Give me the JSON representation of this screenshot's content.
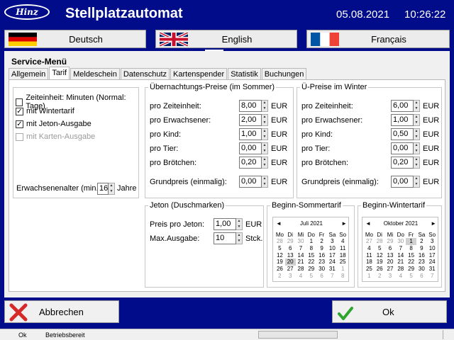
{
  "header": {
    "logo_text": "Hinz",
    "title": "Stellplatzautomat",
    "date": "05.08.2021",
    "time": "10:26:22"
  },
  "languages": [
    {
      "label": "Deutsch",
      "flag": "de-flag"
    },
    {
      "label": "English",
      "flag": "uk-flag"
    },
    {
      "label": "Français",
      "flag": "fr-flag"
    }
  ],
  "panel": {
    "title": "Service-Menü",
    "tabs": [
      "Allgemein",
      "Tarif",
      "Meldeschein",
      "Datenschutz",
      "Kartenspender",
      "Statistik",
      "Buchungen"
    ],
    "active_tab": "Tarif"
  },
  "options": {
    "zeiteinheit": {
      "label": "Zeiteinheit: Minuten (Normal: Tage)",
      "checked": false
    },
    "wintertarif": {
      "label": "mit Wintertarif",
      "checked": true
    },
    "jeton": {
      "label": "mit Jeton-Ausgabe",
      "checked": true
    },
    "karten": {
      "label": "mit Karten-Ausgabe",
      "checked": false,
      "disabled": true
    },
    "erwachsenenalter": {
      "label": "Erwachsenenalter (min.):",
      "value": "16",
      "unit": "Jahre"
    }
  },
  "sommer": {
    "title": "Übernachtungs-Preise (im Sommer)",
    "rows": [
      {
        "label": "pro Zeiteinheit:",
        "value": "8,00",
        "unit": "EUR"
      },
      {
        "label": "pro Erwachsener:",
        "value": "2,00",
        "unit": "EUR"
      },
      {
        "label": "pro Kind:",
        "value": "1,00",
        "unit": "EUR"
      },
      {
        "label": "pro Tier:",
        "value": "0,00",
        "unit": "EUR"
      },
      {
        "label": "pro Brötchen:",
        "value": "0,20",
        "unit": "EUR"
      }
    ],
    "grundpreis": {
      "label": "Grundpreis (einmalig):",
      "value": "0,00",
      "unit": "EUR"
    }
  },
  "winter": {
    "title": "Ü-Preise im Winter",
    "rows": [
      {
        "label": "pro Zeiteinheit:",
        "value": "6,00",
        "unit": "EUR"
      },
      {
        "label": "pro Erwachsener:",
        "value": "1,00",
        "unit": "EUR"
      },
      {
        "label": "pro Kind:",
        "value": "0,50",
        "unit": "EUR"
      },
      {
        "label": "pro Tier:",
        "value": "0,00",
        "unit": "EUR"
      },
      {
        "label": "pro Brötchen:",
        "value": "0,20",
        "unit": "EUR"
      }
    ],
    "grundpreis": {
      "label": "Grundpreis (einmalig):",
      "value": "0,00",
      "unit": "EUR"
    }
  },
  "jeton": {
    "title": "Jeton (Duschmarken)",
    "preis": {
      "label": "Preis pro Jeton:",
      "value": "1,00",
      "unit": "EUR"
    },
    "max": {
      "label": "Max.Ausgabe:",
      "value": "10",
      "unit": "Stck."
    }
  },
  "sommertarif": {
    "title": "Beginn-Sommertarif",
    "month": "Juli 2021",
    "dow": [
      "Mo",
      "Di",
      "Mi",
      "Do",
      "Fr",
      "Sa",
      "So"
    ],
    "weeks": [
      [
        "28",
        "29",
        "30",
        "1",
        "2",
        "3",
        "4"
      ],
      [
        "5",
        "6",
        "7",
        "8",
        "9",
        "10",
        "11"
      ],
      [
        "12",
        "13",
        "14",
        "15",
        "16",
        "17",
        "18"
      ],
      [
        "19",
        "20",
        "21",
        "22",
        "23",
        "24",
        "25"
      ],
      [
        "26",
        "27",
        "28",
        "29",
        "30",
        "31",
        "1"
      ],
      [
        "2",
        "3",
        "4",
        "5",
        "6",
        "7",
        "8"
      ]
    ],
    "other_month": [
      [
        0,
        0
      ],
      [
        0,
        1
      ],
      [
        0,
        2
      ],
      [
        4,
        6
      ],
      [
        5,
        0
      ],
      [
        5,
        1
      ],
      [
        5,
        2
      ],
      [
        5,
        3
      ],
      [
        5,
        4
      ],
      [
        5,
        5
      ],
      [
        5,
        6
      ]
    ],
    "selected": [
      3,
      1
    ]
  },
  "wintertarif": {
    "title": "Beginn-Wintertarif",
    "month": "Oktober 2021",
    "dow": [
      "Mo",
      "Di",
      "Mi",
      "Do",
      "Fr",
      "Sa",
      "So"
    ],
    "weeks": [
      [
        "27",
        "28",
        "29",
        "30",
        "1",
        "2",
        "3"
      ],
      [
        "4",
        "5",
        "6",
        "7",
        "8",
        "9",
        "10"
      ],
      [
        "11",
        "12",
        "13",
        "14",
        "15",
        "16",
        "17"
      ],
      [
        "18",
        "19",
        "20",
        "21",
        "22",
        "23",
        "24"
      ],
      [
        "25",
        "26",
        "27",
        "28",
        "29",
        "30",
        "31"
      ],
      [
        "1",
        "2",
        "3",
        "4",
        "5",
        "6",
        "7"
      ]
    ],
    "other_month": [
      [
        0,
        0
      ],
      [
        0,
        1
      ],
      [
        0,
        2
      ],
      [
        0,
        3
      ],
      [
        5,
        0
      ],
      [
        5,
        1
      ],
      [
        5,
        2
      ],
      [
        5,
        3
      ],
      [
        5,
        4
      ],
      [
        5,
        5
      ],
      [
        5,
        6
      ]
    ],
    "selected": [
      0,
      4
    ]
  },
  "footer": {
    "cancel_label": "Abbrechen",
    "ok_label": "Ok"
  },
  "status": {
    "left": "Ok",
    "middle": "Betriebsbereit"
  },
  "colors": {
    "background": "#000c8a",
    "cancel_icon": "#d42a2a",
    "ok_icon": "#2ea52e"
  }
}
